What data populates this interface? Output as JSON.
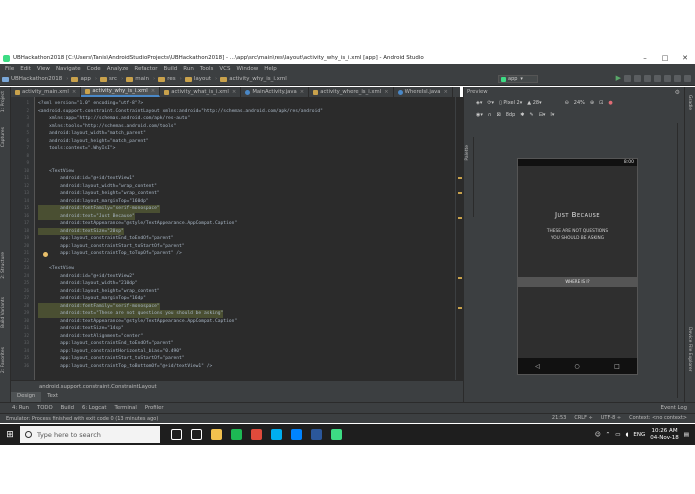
{
  "window": {
    "title": "UBHackathon2018 [C:\\Users\\Tanis\\AndroidStudioProjects\\UBHackathon2018] - ...\\app\\src\\main\\res\\layout\\activity_why_is_i.xml [app] - Android Studio",
    "minimize": "–",
    "maximize": "□",
    "close": "✕"
  },
  "menu": [
    "File",
    "Edit",
    "View",
    "Navigate",
    "Code",
    "Analyze",
    "Refactor",
    "Build",
    "Run",
    "Tools",
    "VCS",
    "Window",
    "Help"
  ],
  "navbar": {
    "crumbs": [
      "UBHackathon2018",
      "app",
      "src",
      "main",
      "res",
      "layout",
      "activity_why_is_i.xml"
    ],
    "run_config": "app"
  },
  "tabs": [
    {
      "label": "activity_main.xml",
      "active": false,
      "kind": "xml"
    },
    {
      "label": "activity_why_is_i.xml",
      "active": true,
      "kind": "xml"
    },
    {
      "label": "activity_what_is_i.xml",
      "active": false,
      "kind": "xml"
    },
    {
      "label": "MainActivity.java",
      "active": false,
      "kind": "java"
    },
    {
      "label": "activity_where_is_i.xml",
      "active": false,
      "kind": "xml"
    },
    {
      "label": "WhereIsI.java",
      "active": false,
      "kind": "java"
    }
  ],
  "left_tool_labels": [
    "1: Project",
    "Captures",
    "2: Structure",
    "Build Variants",
    "2: Favorites"
  ],
  "right_tool_labels": [
    "Gradle",
    "Device File Explorer"
  ],
  "code_lines": [
    {
      "n": "1",
      "t": "<?xml version=\"1.0\" encoding=\"utf-8\"?>",
      "h": false
    },
    {
      "n": "2",
      "t": "<android.support.constraint.ConstraintLayout xmlns:android=\"http://schemas.android.com/apk/res/android\"",
      "h": false
    },
    {
      "n": "3",
      "t": "    xmlns:app=\"http://schemas.android.com/apk/res-auto\"",
      "h": false
    },
    {
      "n": "4",
      "t": "    xmlns:tools=\"http://schemas.android.com/tools\"",
      "h": false
    },
    {
      "n": "5",
      "t": "    android:layout_width=\"match_parent\"",
      "h": false
    },
    {
      "n": "6",
      "t": "    android:layout_height=\"match_parent\"",
      "h": false
    },
    {
      "n": "7",
      "t": "    tools:context=\".WhyIsI\">",
      "h": false
    },
    {
      "n": "8",
      "t": "",
      "h": false
    },
    {
      "n": "9",
      "t": "",
      "h": false
    },
    {
      "n": "10",
      "t": "    <TextView",
      "h": false
    },
    {
      "n": "11",
      "t": "        android:id=\"@+id/textView1\"",
      "h": false
    },
    {
      "n": "12",
      "t": "        android:layout_width=\"wrap_content\"",
      "h": false
    },
    {
      "n": "13",
      "t": "        android:layout_height=\"wrap_content\"",
      "h": false
    },
    {
      "n": "14",
      "t": "        android:layout_marginTop=\"160dp\"",
      "h": false
    },
    {
      "n": "15",
      "t": "        android:fontFamily=\"serif-monospace\"",
      "h": true
    },
    {
      "n": "16",
      "t": "        android:text=\"Just Because\"",
      "h": true
    },
    {
      "n": "17",
      "t": "        android:textAppearance=\"@style/TextAppearance.AppCompat.Caption\"",
      "h": false
    },
    {
      "n": "18",
      "t": "        android:textSize=\"20sp\"",
      "h": true
    },
    {
      "n": "19",
      "t": "        app:layout_constraintEnd_toEndOf=\"parent\"",
      "h": false
    },
    {
      "n": "20",
      "t": "        app:layout_constraintStart_toStartOf=\"parent\"",
      "h": false
    },
    {
      "n": "21",
      "t": "        app:layout_constraintTop_toTopOf=\"parent\" />",
      "h": false
    },
    {
      "n": "22",
      "t": "",
      "h": false
    },
    {
      "n": "23",
      "t": "    <TextView",
      "h": false
    },
    {
      "n": "24",
      "t": "        android:id=\"@+id/textView2\"",
      "h": false
    },
    {
      "n": "25",
      "t": "        android:layout_width=\"210dp\"",
      "h": false
    },
    {
      "n": "26",
      "t": "        android:layout_height=\"wrap_content\"",
      "h": false
    },
    {
      "n": "27",
      "t": "        android:layout_marginTop=\"16dp\"",
      "h": false
    },
    {
      "n": "28",
      "t": "        android:fontFamily=\"serif-monospace\"",
      "h": true
    },
    {
      "n": "29",
      "t": "        android:text=\"These are not questions you should be asking\"",
      "h": true
    },
    {
      "n": "30",
      "t": "        android:textAppearance=\"@style/TextAppearance.AppCompat.Caption\"",
      "h": false
    },
    {
      "n": "31",
      "t": "        android:textSize=\"14sp\"",
      "h": false
    },
    {
      "n": "32",
      "t": "        android:textAlignment=\"center\"",
      "h": false
    },
    {
      "n": "33",
      "t": "        app:layout_constraintEnd_toEndOf=\"parent\"",
      "h": false
    },
    {
      "n": "34",
      "t": "        app:layout_constraintHorizontal_bias=\"0.490\"",
      "h": false
    },
    {
      "n": "35",
      "t": "        app:layout_constraintStart_toStartOf=\"parent\"",
      "h": false
    },
    {
      "n": "36",
      "t": "        app:layout_constraintTop_toBottomOf=\"@+id/textView1\" />",
      "h": false
    }
  ],
  "crumb_path": "android.support.constraint.ConstraintLayout",
  "design_tabs": [
    {
      "label": "Design",
      "active": true
    },
    {
      "label": "Text",
      "active": false
    }
  ],
  "preview": {
    "title": "Preview",
    "device": "Pixel 2",
    "api": "28",
    "zoom": "24%",
    "status_time": "8:00",
    "heading": "Just Because",
    "subtext": "THESE ARE NOT QUESTIONS\nYOU SHOULD BE ASKING",
    "button": "WHERE IS I?",
    "nav": [
      "◁",
      "○",
      "□"
    ]
  },
  "bottom_tools": [
    "4: Run",
    "TODO",
    "Build",
    "6: Logcat",
    "Terminal",
    "Profiler"
  ],
  "event_log": "Event Log",
  "status": {
    "message": "Emulator: Process finished with exit code 0 (13 minutes ago)",
    "position": "21:53",
    "line_sep": "CRLF ÷",
    "encoding": "UTF-8 ÷",
    "context": "Context: <no context>"
  },
  "taskbar": {
    "search_placeholder": "Type here to search",
    "time": "10:26 AM",
    "date": "04-Nov-18",
    "lang": "ENG",
    "apps": [
      {
        "name": "task-view-icon",
        "color": "#ffffff"
      },
      {
        "name": "store-icon",
        "color": "#ffffff"
      },
      {
        "name": "file-explorer-icon",
        "color": "#f2c14e"
      },
      {
        "name": "spotify-icon",
        "color": "#1db954"
      },
      {
        "name": "chrome-icon",
        "color": "#e04a3b"
      },
      {
        "name": "skype-icon",
        "color": "#00aff0"
      },
      {
        "name": "messenger-icon",
        "color": "#0084ff"
      },
      {
        "name": "word-icon",
        "color": "#2b579a"
      },
      {
        "name": "android-studio-icon",
        "color": "#3ddc84"
      }
    ]
  }
}
